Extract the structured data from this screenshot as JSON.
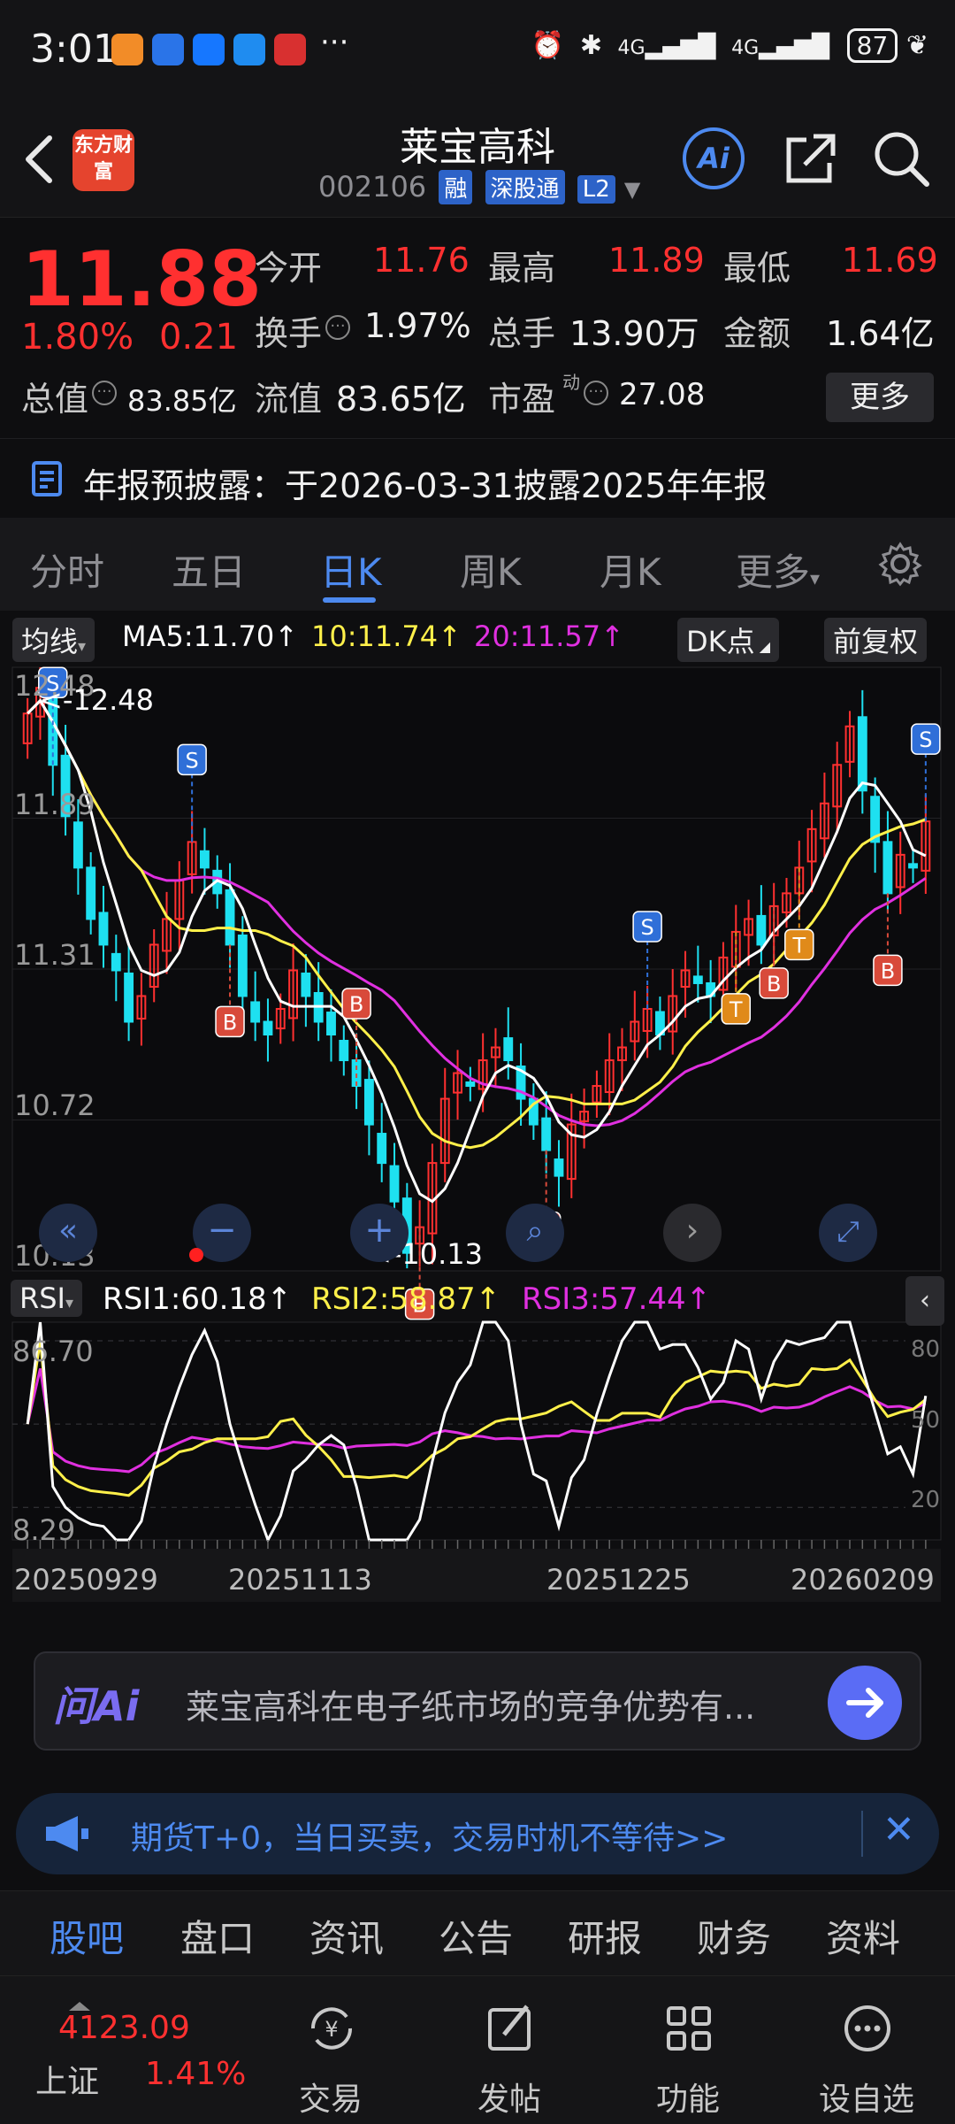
{
  "status": {
    "time": "3:01",
    "network": "4G",
    "battery": "87"
  },
  "header": {
    "back_icon": "chevron-left-icon",
    "logo_text": "东方财富",
    "title": "莱宝高科",
    "code": "002106",
    "tags": [
      "融",
      "深股通",
      "L2"
    ],
    "ai_label": "Ai"
  },
  "quote": {
    "price": "11.88",
    "change_pct": "1.80%",
    "change_abs": "0.21",
    "open_label": "今开",
    "open": "11.76",
    "high_label": "最高",
    "high": "11.89",
    "low_label": "最低",
    "low": "11.69",
    "turnover_label": "换手",
    "turnover": "1.97%",
    "volume_label": "总手",
    "volume": "13.90万",
    "amount_label": "金额",
    "amount": "1.64亿",
    "mktcap_label": "总值",
    "mktcap": "83.85亿",
    "float_label": "流值",
    "float": "83.65亿",
    "pe_label": "市盈",
    "pe_sup": "动",
    "pe": "27.08",
    "more_label": "更多"
  },
  "notice": {
    "text": "年报预披露：于2026-03-31披露2025年年报"
  },
  "tabs": [
    "分时",
    "五日",
    "日K",
    "周K",
    "月K",
    "更多"
  ],
  "chart_bar": {
    "ma_button": "均线",
    "ma5": "MA5:11.70↑",
    "ma10": "10:11.74↑",
    "ma20": "20:11.57↑",
    "dk_button": "DK点",
    "adjust_button": "前复权"
  },
  "kline": {
    "y_ticks": [
      "12.48",
      "11.89",
      "11.31",
      "10.72",
      "10.13"
    ],
    "max_label": "<-12.48",
    "min_label": "<-10.13",
    "marker_b": "B",
    "marker_s": "S",
    "marker_t": "T"
  },
  "rsi": {
    "button": "RSI",
    "rsi1": "RSI1:60.18↑",
    "rsi2": "RSI2:58.87↑",
    "rsi3": "RSI3:57.44↑",
    "y_top": "86.70",
    "y_bottom": "8.29",
    "right_80": "80",
    "right_50": "50",
    "right_20": "20"
  },
  "x_dates": [
    "20250929",
    "20251113",
    "20251225",
    "20260209"
  ],
  "colors": {
    "up": "#ff3030",
    "down": "#1ee0f0",
    "ma5": "#ffffff",
    "ma10": "#fff04a",
    "ma20": "#e030e0",
    "accent": "#4d8af0"
  },
  "ai_bar": {
    "logo": "问Ai",
    "question": "莱宝高科在电子纸市场的竞争优势有..."
  },
  "banner": {
    "text": "期货T+0，当日买卖，交易时机不等待>>"
  },
  "bottom_tabs": [
    "股吧",
    "盘口",
    "资讯",
    "公告",
    "研报",
    "财务",
    "资料"
  ],
  "dock": {
    "index_value": "4123.09",
    "index_name": "上证",
    "index_pct": "1.41%",
    "items": [
      "交易",
      "发帖",
      "功能",
      "设自选"
    ]
  },
  "chart_data": {
    "type": "candlestick",
    "series": [
      {
        "name": "MA5",
        "value": 11.7
      },
      {
        "name": "10",
        "value": 11.74
      },
      {
        "name": "20",
        "value": 11.57
      }
    ],
    "ylim": [
      10.13,
      12.48
    ],
    "x_ticks": [
      "20250929",
      "20251113",
      "20251225",
      "20260209"
    ],
    "close_path": [
      12.3,
      12.4,
      12.1,
      11.9,
      11.7,
      11.5,
      11.4,
      11.3,
      11.1,
      11.2,
      11.4,
      11.5,
      11.65,
      11.8,
      11.7,
      11.6,
      11.4,
      11.2,
      11.1,
      11.05,
      11.15,
      11.3,
      11.2,
      11.1,
      11.05,
      10.95,
      10.85,
      10.7,
      10.55,
      10.4,
      10.2,
      10.3,
      10.55,
      10.8,
      10.9,
      10.85,
      10.95,
      11.0,
      10.95,
      10.8,
      10.7,
      10.6,
      10.5,
      10.7,
      10.75,
      10.85,
      10.95,
      11.0,
      11.1,
      11.15,
      11.05,
      11.2,
      11.3,
      11.25,
      11.2,
      11.35,
      11.45,
      11.5,
      11.4,
      11.55,
      11.6,
      11.7,
      11.85,
      11.95,
      12.1,
      12.25,
      12.0,
      11.8,
      11.6,
      11.75,
      11.7,
      11.88
    ],
    "rsi": {
      "ylim": [
        8.29,
        86.7
      ],
      "rsi1_last": 60.18,
      "rsi2_last": 58.87,
      "rsi3_last": 57.44
    }
  }
}
